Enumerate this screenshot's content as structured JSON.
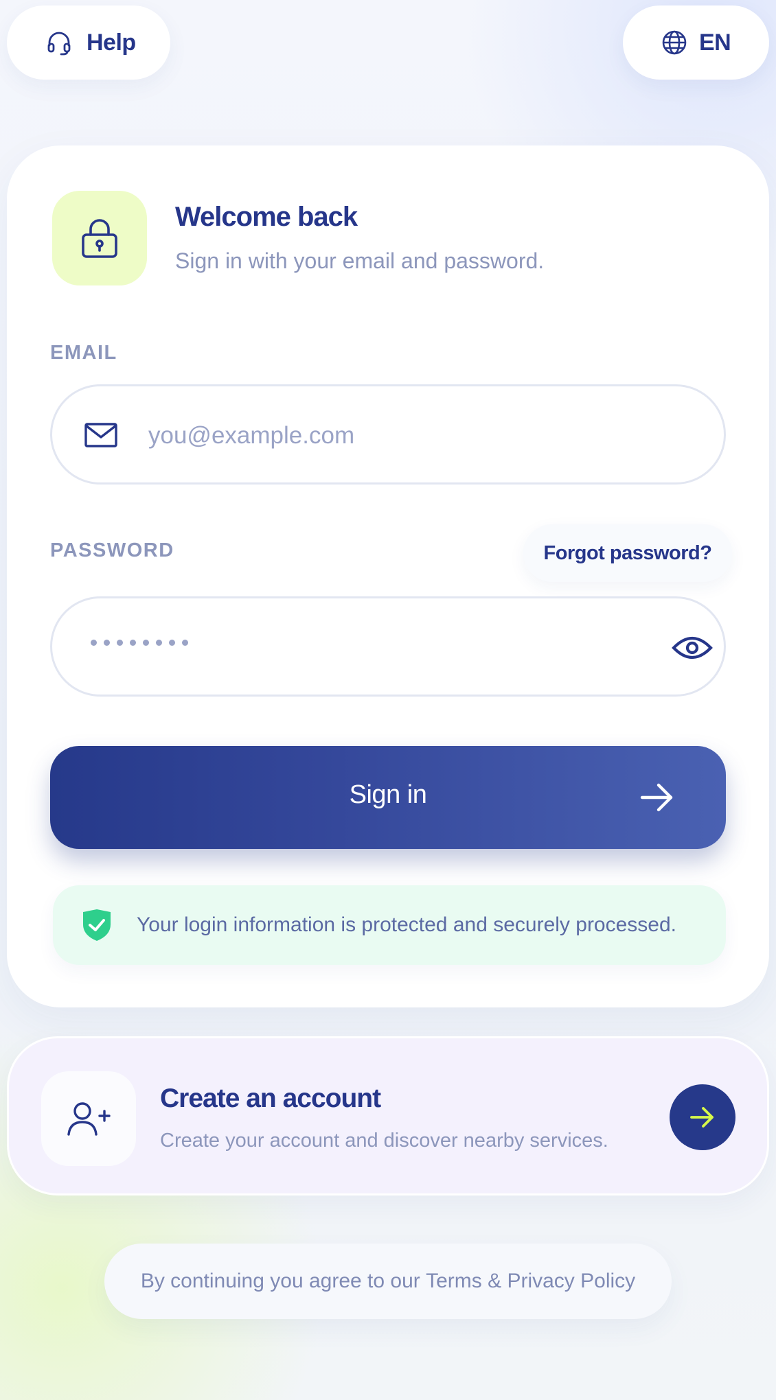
{
  "header": {
    "help_label": "Help",
    "help_icon": "headset-icon",
    "language_label": "EN",
    "language_icon": "globe-icon"
  },
  "login": {
    "icon": "lock-icon",
    "title": "Welcome back",
    "subtitle": "Sign in with your email and password.",
    "email_label": "EMAIL",
    "email_placeholder": "you@example.com",
    "email_value": "",
    "email_icon": "mail-icon",
    "password_label": "PASSWORD",
    "password_masked": "••••••••",
    "password_icon": "eye-icon",
    "forgot_label": "Forgot password?",
    "signin_label": "Sign in",
    "signin_icon": "arrow-right-icon",
    "security_note": "Your login information is protected and securely processed.",
    "security_icon": "shield-check-icon"
  },
  "create_account": {
    "icon": "user-plus-icon",
    "title": "Create an account",
    "subtitle": "Create your account and discover nearby services.",
    "arrow_icon": "arrow-right-icon"
  },
  "footer": {
    "prefix": "By continuing you agree to our ",
    "terms_label": "Terms",
    "joiner": " & ",
    "privacy_label": "Privacy Policy"
  },
  "colors": {
    "primary": "#26398a",
    "lime_accent": "#eefcc7",
    "success_green": "#2ecf8c",
    "muted_text": "#8c96bb"
  }
}
